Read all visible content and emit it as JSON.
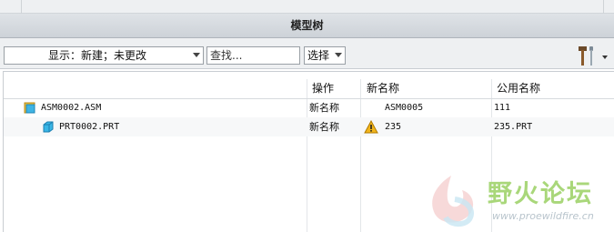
{
  "panel": {
    "title": "模型树"
  },
  "toolbar": {
    "display_label": "显示：新建；未更改",
    "search_value": "查找...",
    "select_label": "选择",
    "tools_icon": "hammer-wrench-icon"
  },
  "columns": {
    "action": "操作",
    "new_name": "新名称",
    "common_name": "公用名称"
  },
  "rows": [
    {
      "name": "ASM0002.ASM",
      "icon": "assembly-icon",
      "action": "新名称",
      "new_name": "ASM0005",
      "common_name": "111",
      "warning": false
    },
    {
      "name": "PRT0002.PRT",
      "icon": "part-icon",
      "action": "新名称",
      "new_name": "235",
      "common_name": "235.PRT",
      "warning": true
    }
  ],
  "watermark": {
    "title": "野火论坛",
    "url": "www.proewildfire.cn"
  },
  "colors": {
    "watermark_green": "#a9d77a",
    "warning_yellow": "#f2b51c",
    "icon_blue": "#39b6e6"
  }
}
